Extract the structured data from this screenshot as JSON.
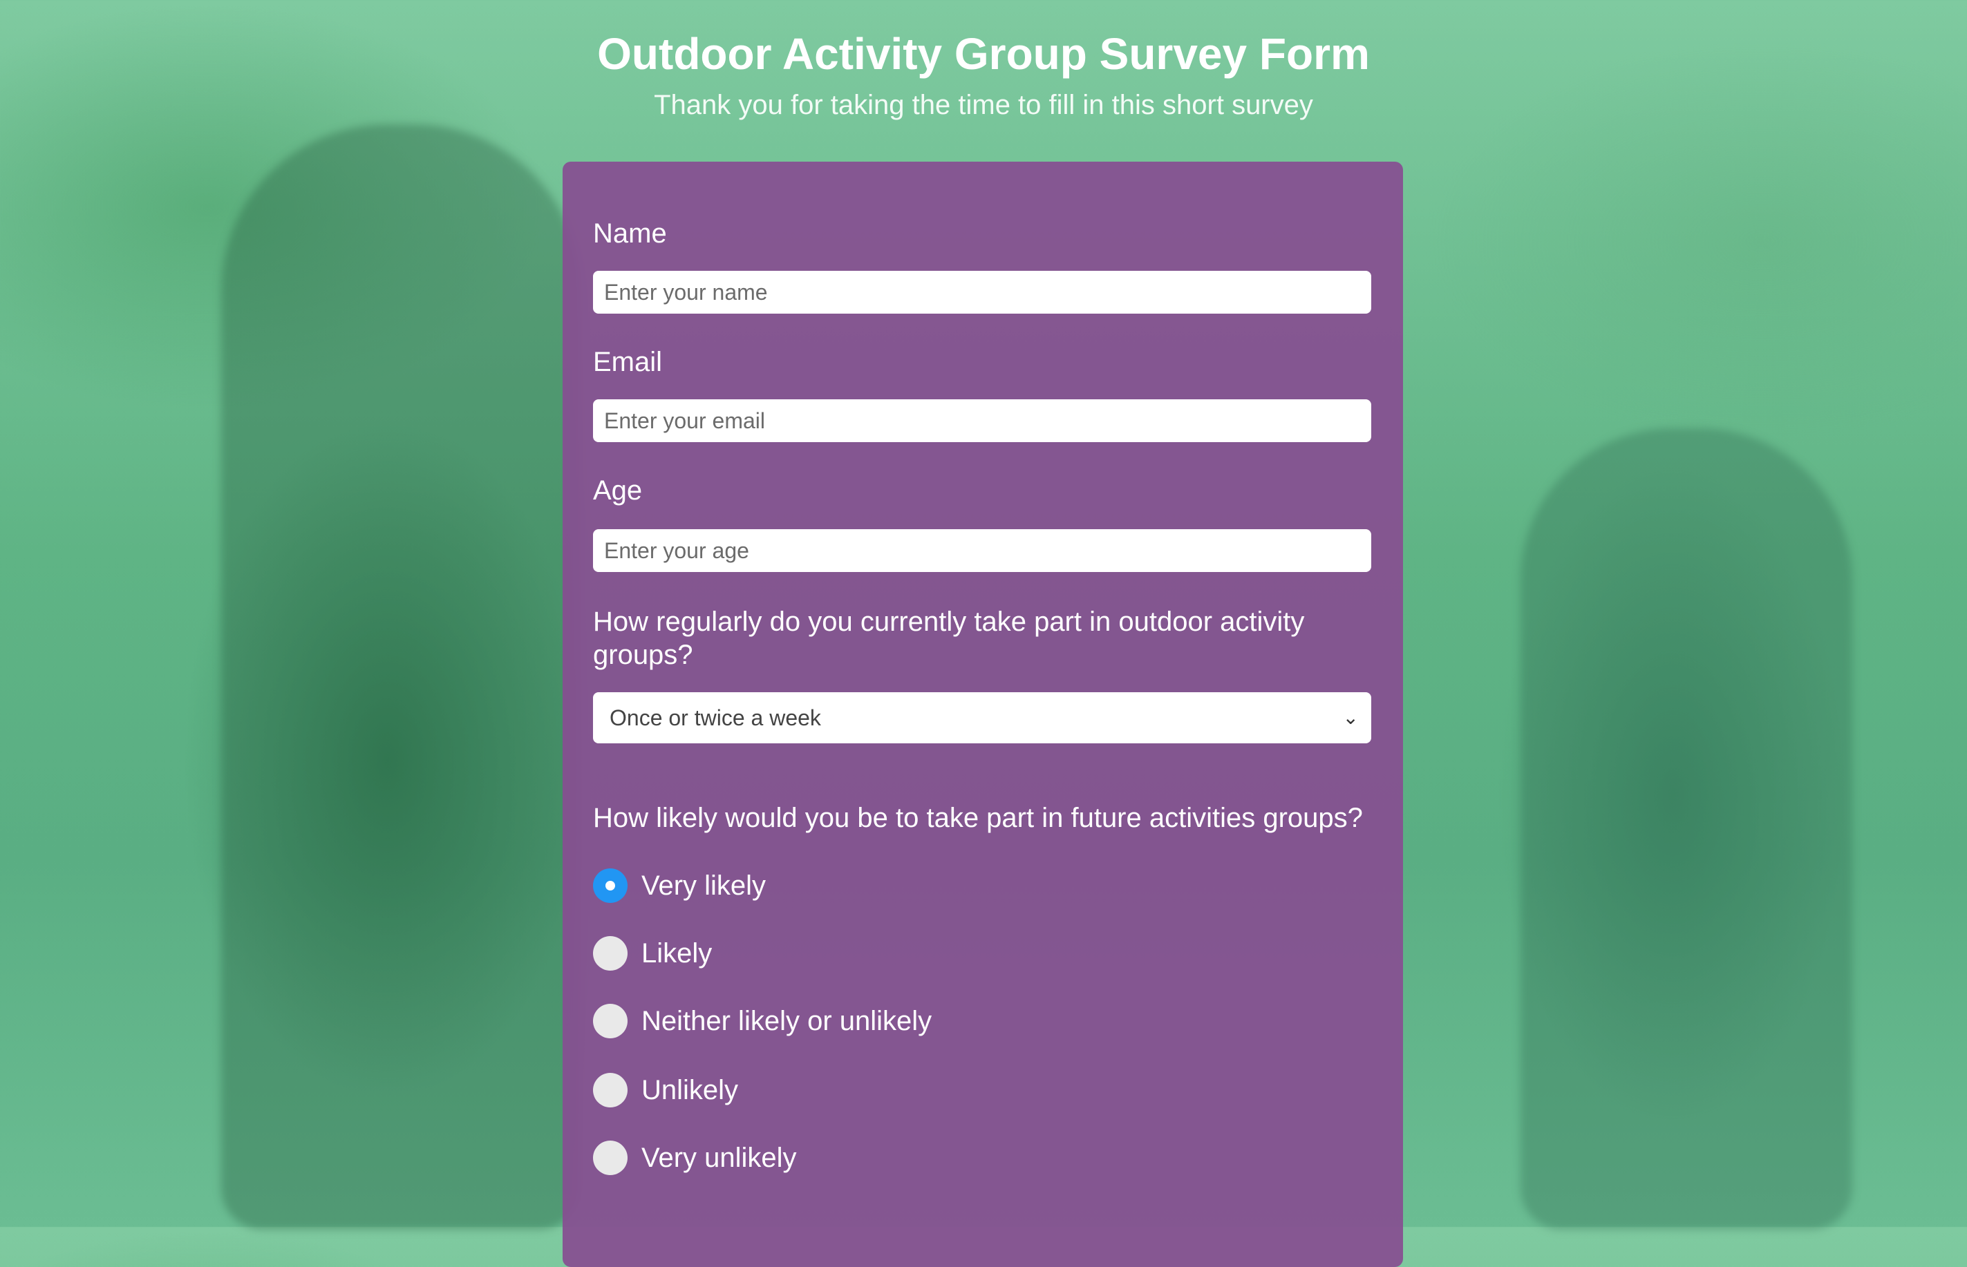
{
  "page": {
    "title": "Outdoor Activity Group Survey Form",
    "subtitle": "Thank you for taking the time to fill in this short survey"
  },
  "form": {
    "name": {
      "label": "Name",
      "placeholder": "Enter your name",
      "value": ""
    },
    "email": {
      "label": "Email",
      "placeholder": "Enter your email",
      "value": ""
    },
    "age": {
      "label": "Age",
      "placeholder": "Enter your age",
      "value": ""
    },
    "frequency": {
      "question": "How regularly do you currently take part in outdoor activity groups?",
      "selected": "Once or twice a week"
    },
    "likelihood": {
      "question": "How likely would you be to take part in future activities groups?",
      "options": [
        {
          "label": "Very likely",
          "checked": true
        },
        {
          "label": "Likely",
          "checked": false
        },
        {
          "label": "Neither likely or unlikely",
          "checked": false
        },
        {
          "label": "Unlikely",
          "checked": false
        },
        {
          "label": "Very unlikely",
          "checked": false
        }
      ]
    }
  },
  "colors": {
    "background": "#6bbd93",
    "card": "#864f91",
    "radio_selected": "#2196f3",
    "radio_unselected": "#e9e9e9"
  },
  "icons": {
    "select_chevron": "chevron-down-icon"
  }
}
